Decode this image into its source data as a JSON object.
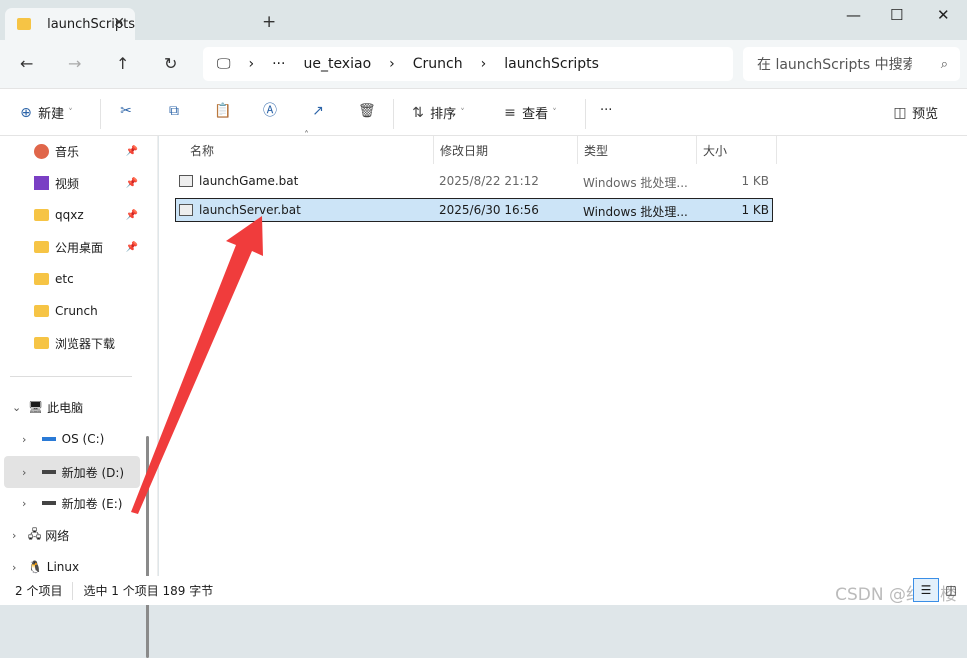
{
  "window": {
    "tab_title": "launchScripts",
    "close_tab": "✕",
    "new_tab": "+",
    "minimize": "—",
    "maximize": "☐",
    "close": "✕"
  },
  "nav": {
    "breadcrumb": [
      "···",
      "ue_texiao",
      "Crunch",
      "launchScripts"
    ],
    "search_placeholder": "在 launchScripts 中搜索"
  },
  "toolbar": {
    "new": "新建",
    "sort": "排序",
    "view": "查看",
    "more": "···",
    "preview": "预览"
  },
  "sidebar": {
    "quick": [
      {
        "label": "音乐"
      },
      {
        "label": "视频"
      },
      {
        "label": "qqxz"
      },
      {
        "label": "公用桌面"
      },
      {
        "label": "etc"
      },
      {
        "label": "Crunch"
      },
      {
        "label": "浏览器下载"
      }
    ],
    "this_pc": "此电脑",
    "drives": [
      "OS (C:)",
      "新加卷 (D:)",
      "新加卷 (E:)"
    ],
    "network": "网络",
    "linux": "Linux"
  },
  "columns": [
    "名称",
    "修改日期",
    "类型",
    "大小"
  ],
  "files": [
    {
      "name": "launchGame.bat",
      "date": "2025/8/22 21:12",
      "type": "Windows 批处理...",
      "size": "1 KB"
    },
    {
      "name": "launchServer.bat",
      "date": "2025/6/30 16:56",
      "type": "Windows 批处理...",
      "size": "1 KB"
    }
  ],
  "status": {
    "count": "2 个项目",
    "selected": "选中 1 个项目  189 字节"
  },
  "watermark": "CSDN @红雨楼",
  "colors": {
    "arrow": "#f03c3c",
    "selection": "#cce4f7"
  }
}
